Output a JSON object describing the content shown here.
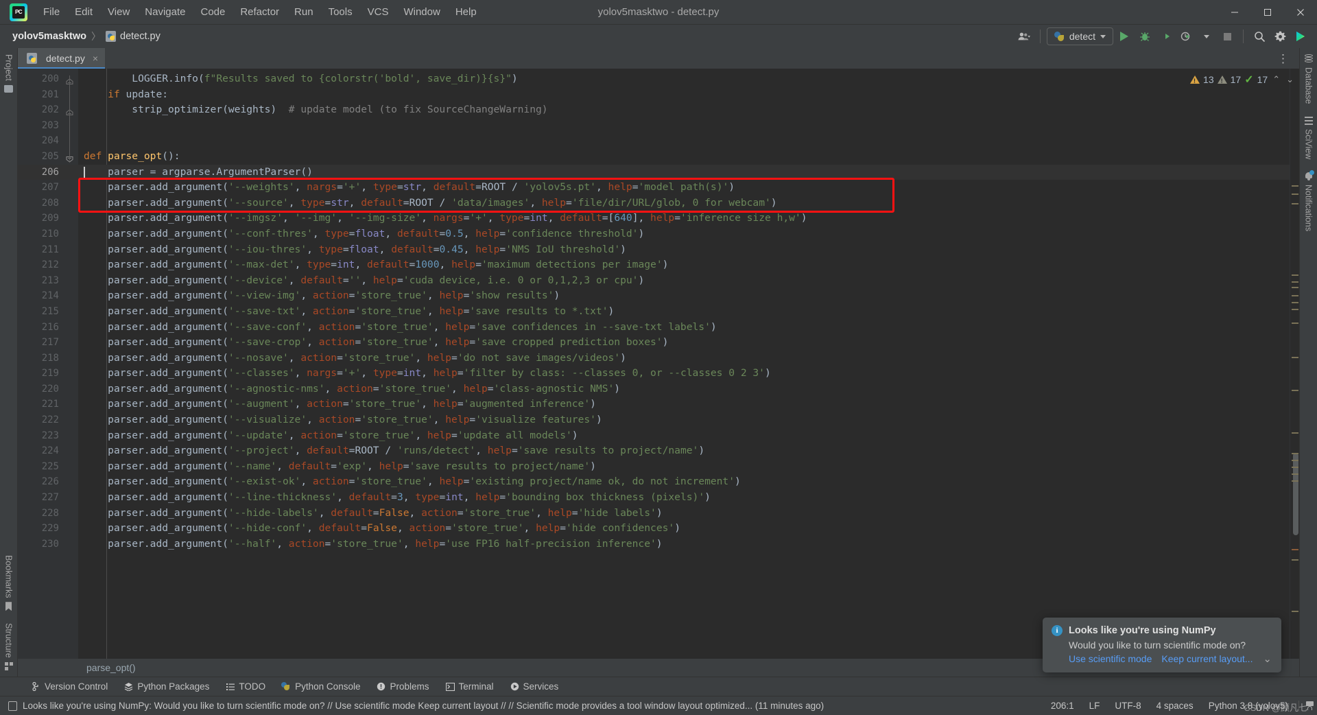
{
  "window": {
    "title": "yolov5masktwo - detect.py",
    "minimize": "–",
    "maximize": "☐",
    "close": "✕"
  },
  "menu": {
    "items": [
      {
        "label": "File"
      },
      {
        "label": "Edit"
      },
      {
        "label": "View"
      },
      {
        "label": "Navigate"
      },
      {
        "label": "Code"
      },
      {
        "label": "Refactor"
      },
      {
        "label": "Run"
      },
      {
        "label": "Tools"
      },
      {
        "label": "VCS"
      },
      {
        "label": "Window"
      },
      {
        "label": "Help"
      }
    ]
  },
  "breadcrumb": {
    "project": "yolov5masktwo",
    "separator": "〉",
    "file": "detect.py"
  },
  "toolbar": {
    "run_config": "detect",
    "run_tooltip": "Run",
    "debug_tooltip": "Debug",
    "coverage_tooltip": "Run with Coverage",
    "profile_tooltip": "Profile",
    "stop_tooltip": "Stop",
    "search_tooltip": "Search Everywhere",
    "settings_tooltip": "Settings",
    "updates_tooltip": "Updates"
  },
  "tabs": [
    {
      "label": "detect.py",
      "close": "×"
    }
  ],
  "left_strip": [
    {
      "label": "Project",
      "icon": "folder-icon"
    },
    {
      "label": "Bookmarks",
      "icon": "bookmark-icon"
    },
    {
      "label": "Structure",
      "icon": "structure-icon"
    }
  ],
  "right_strip": [
    {
      "label": "Database",
      "icon": "database-icon"
    },
    {
      "label": "SciView",
      "icon": "sciview-icon"
    },
    {
      "label": "Notifications",
      "icon": "bell-icon"
    }
  ],
  "inspections": {
    "warnings": "13",
    "weak_warnings": "17",
    "checks": "17",
    "up": "⌃",
    "down": "⌄"
  },
  "editor": {
    "first_line": 200,
    "current_line": 206,
    "breadcrumb": "parse_opt()",
    "lines": [
      {
        "n": 200,
        "indent": 2,
        "text": "        LOGGER.info(f\"Results saved to {colorstr('bold', save_dir)}{s}\")"
      },
      {
        "n": 201,
        "indent": 1,
        "text": "    if update:"
      },
      {
        "n": 202,
        "indent": 2,
        "text": "        strip_optimizer(weights)  # update model (to fix SourceChangeWarning)"
      },
      {
        "n": 203,
        "indent": 0,
        "text": ""
      },
      {
        "n": 204,
        "indent": 0,
        "text": ""
      },
      {
        "n": 205,
        "indent": 0,
        "text": "def parse_opt():"
      },
      {
        "n": 206,
        "indent": 1,
        "text": "    parser = argparse.ArgumentParser()"
      },
      {
        "n": 207,
        "indent": 1,
        "text": "    parser.add_argument('--weights', nargs='+', type=str, default=ROOT / 'yolov5s.pt', help='model path(s)')"
      },
      {
        "n": 208,
        "indent": 1,
        "text": "    parser.add_argument('--source', type=str, default=ROOT / 'data/images', help='file/dir/URL/glob, 0 for webcam')"
      },
      {
        "n": 209,
        "indent": 1,
        "text": "    parser.add_argument('--imgsz', '--img', '--img-size', nargs='+', type=int, default=[640], help='inference size h,w')"
      },
      {
        "n": 210,
        "indent": 1,
        "text": "    parser.add_argument('--conf-thres', type=float, default=0.5, help='confidence threshold')"
      },
      {
        "n": 211,
        "indent": 1,
        "text": "    parser.add_argument('--iou-thres', type=float, default=0.45, help='NMS IoU threshold')"
      },
      {
        "n": 212,
        "indent": 1,
        "text": "    parser.add_argument('--max-det', type=int, default=1000, help='maximum detections per image')"
      },
      {
        "n": 213,
        "indent": 1,
        "text": "    parser.add_argument('--device', default='', help='cuda device, i.e. 0 or 0,1,2,3 or cpu')"
      },
      {
        "n": 214,
        "indent": 1,
        "text": "    parser.add_argument('--view-img', action='store_true', help='show results')"
      },
      {
        "n": 215,
        "indent": 1,
        "text": "    parser.add_argument('--save-txt', action='store_true', help='save results to *.txt')"
      },
      {
        "n": 216,
        "indent": 1,
        "text": "    parser.add_argument('--save-conf', action='store_true', help='save confidences in --save-txt labels')"
      },
      {
        "n": 217,
        "indent": 1,
        "text": "    parser.add_argument('--save-crop', action='store_true', help='save cropped prediction boxes')"
      },
      {
        "n": 218,
        "indent": 1,
        "text": "    parser.add_argument('--nosave', action='store_true', help='do not save images/videos')"
      },
      {
        "n": 219,
        "indent": 1,
        "text": "    parser.add_argument('--classes', nargs='+', type=int, help='filter by class: --classes 0, or --classes 0 2 3')"
      },
      {
        "n": 220,
        "indent": 1,
        "text": "    parser.add_argument('--agnostic-nms', action='store_true', help='class-agnostic NMS')"
      },
      {
        "n": 221,
        "indent": 1,
        "text": "    parser.add_argument('--augment', action='store_true', help='augmented inference')"
      },
      {
        "n": 222,
        "indent": 1,
        "text": "    parser.add_argument('--visualize', action='store_true', help='visualize features')"
      },
      {
        "n": 223,
        "indent": 1,
        "text": "    parser.add_argument('--update', action='store_true', help='update all models')"
      },
      {
        "n": 224,
        "indent": 1,
        "text": "    parser.add_argument('--project', default=ROOT / 'runs/detect', help='save results to project/name')"
      },
      {
        "n": 225,
        "indent": 1,
        "text": "    parser.add_argument('--name', default='exp', help='save results to project/name')"
      },
      {
        "n": 226,
        "indent": 1,
        "text": "    parser.add_argument('--exist-ok', action='store_true', help='existing project/name ok, do not increment')"
      },
      {
        "n": 227,
        "indent": 1,
        "text": "    parser.add_argument('--line-thickness', default=3, type=int, help='bounding box thickness (pixels)')"
      },
      {
        "n": 228,
        "indent": 1,
        "text": "    parser.add_argument('--hide-labels', default=False, action='store_true', help='hide labels')"
      },
      {
        "n": 229,
        "indent": 1,
        "text": "    parser.add_argument('--hide-conf', default=False, action='store_true', help='hide confidences')"
      },
      {
        "n": 230,
        "indent": 1,
        "text": "    parser.add_argument('--half', action='store_true', help='use FP16 half-precision inference')"
      }
    ],
    "annotation": {
      "color": "#fd1212",
      "covers_lines": [
        207,
        208
      ]
    }
  },
  "bottom_tools": [
    {
      "label": "Version Control",
      "icon": "branch-icon"
    },
    {
      "label": "Python Packages",
      "icon": "packages-icon"
    },
    {
      "label": "TODO",
      "icon": "todo-icon"
    },
    {
      "label": "Python Console",
      "icon": "python-icon"
    },
    {
      "label": "Problems",
      "icon": "problems-icon"
    },
    {
      "label": "Terminal",
      "icon": "terminal-icon"
    },
    {
      "label": "Services",
      "icon": "services-icon"
    }
  ],
  "notification": {
    "title": "Looks like you're using NumPy",
    "body": "Would you like to turn scientific mode on?",
    "link_primary": "Use scientific mode",
    "link_secondary": "Keep current layout...",
    "collapse": "⌄",
    "accent": "#3592c4"
  },
  "statusbar": {
    "message": "Looks like you're using NumPy: Would you like to turn scientific mode on? // Use scientific mode  Keep current layout // // Scientific mode provides a tool window layout optimized... (11 minutes ago)",
    "caret": "206:1",
    "line_sep": "LF",
    "encoding": "UTF-8",
    "indent": "4 spaces",
    "interpreter": "Python 3.8 (yolov5)"
  },
  "watermark": "CSDN @顾凡七"
}
